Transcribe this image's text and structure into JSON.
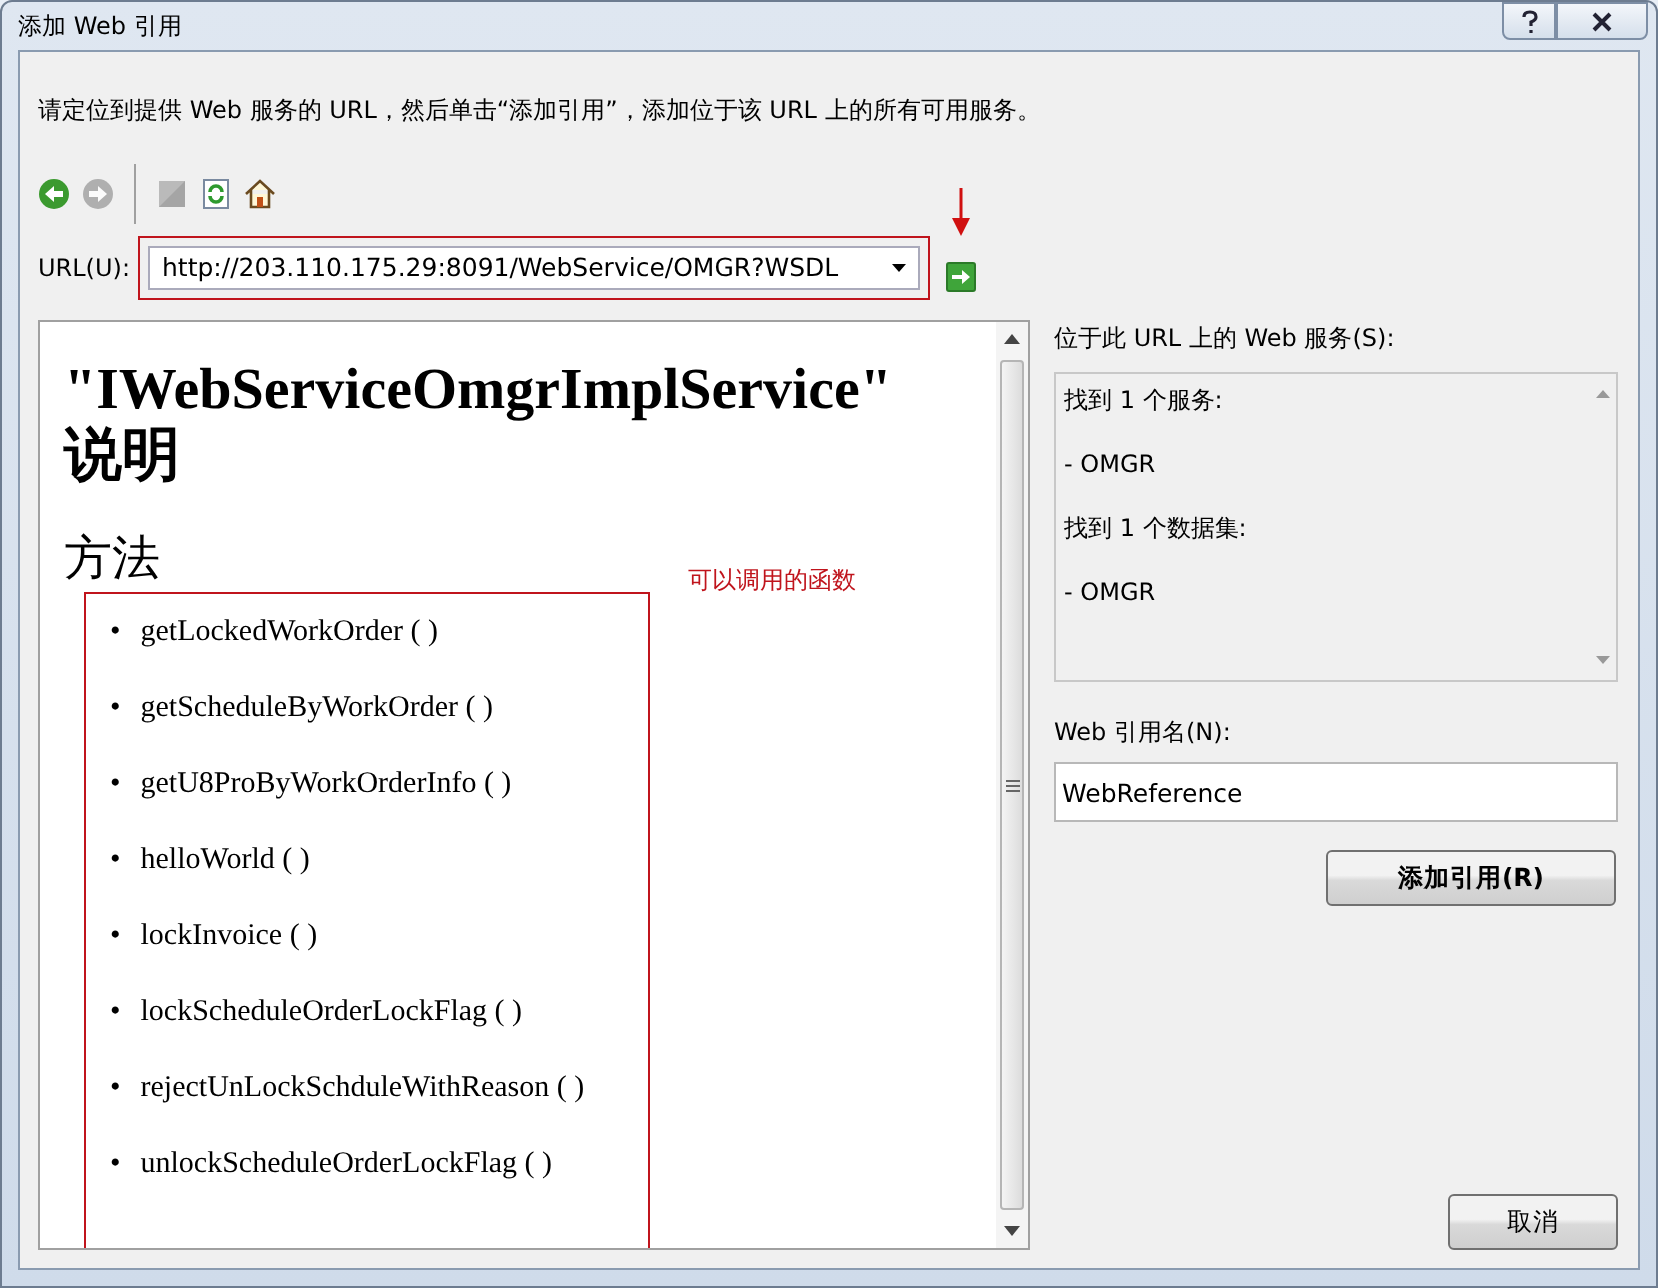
{
  "window": {
    "title": "添加 Web 引用"
  },
  "instruction": "请定位到提供 Web 服务的 URL，然后单击“添加引用”，添加位于该 URL 上的所有可用服务。",
  "toolbar": [
    {
      "kind": "back",
      "disabled": false
    },
    {
      "kind": "forward",
      "disabled": true
    },
    {
      "kind": "stop",
      "disabled": true
    },
    {
      "kind": "refresh",
      "disabled": false
    },
    {
      "kind": "home",
      "disabled": false
    }
  ],
  "url": {
    "label": "URL(U):",
    "value": "http://203.110.175.29:8091/WebService/OMGR?WSDL"
  },
  "browser": {
    "heading": "\"IWebServiceOmgrImplService\" 说明",
    "section": "方法",
    "annotation": "可以调用的函数",
    "methods": [
      {
        "bullet": "•",
        "name": "getLockedWorkOrder ( )"
      },
      {
        "bullet": "•",
        "name": "getScheduleByWorkOrder ( )"
      },
      {
        "bullet": "•",
        "name": "getU8ProByWorkOrderInfo ( )"
      },
      {
        "bullet": "•",
        "name": "helloWorld ( )"
      },
      {
        "bullet": "•",
        "name": "lockInvoice ( )"
      },
      {
        "bullet": "•",
        "name": "lockScheduleOrderLockFlag ( )"
      },
      {
        "bullet": "•",
        "name": "rejectUnLockSchduleWithReason ( )"
      },
      {
        "bullet": "•",
        "name": "unlockScheduleOrderLockFlag ( )"
      }
    ]
  },
  "services": {
    "label": "位于此 URL 上的 Web 服务(S):",
    "lines": [
      "找到 1 个服务:",
      "- OMGR",
      "找到 1 个数据集:",
      "- OMGR"
    ]
  },
  "reference_name": {
    "label": "Web 引用名(N):",
    "value": "WebReference"
  },
  "buttons": {
    "add_reference": "添加引用(R)",
    "cancel": "取消"
  }
}
